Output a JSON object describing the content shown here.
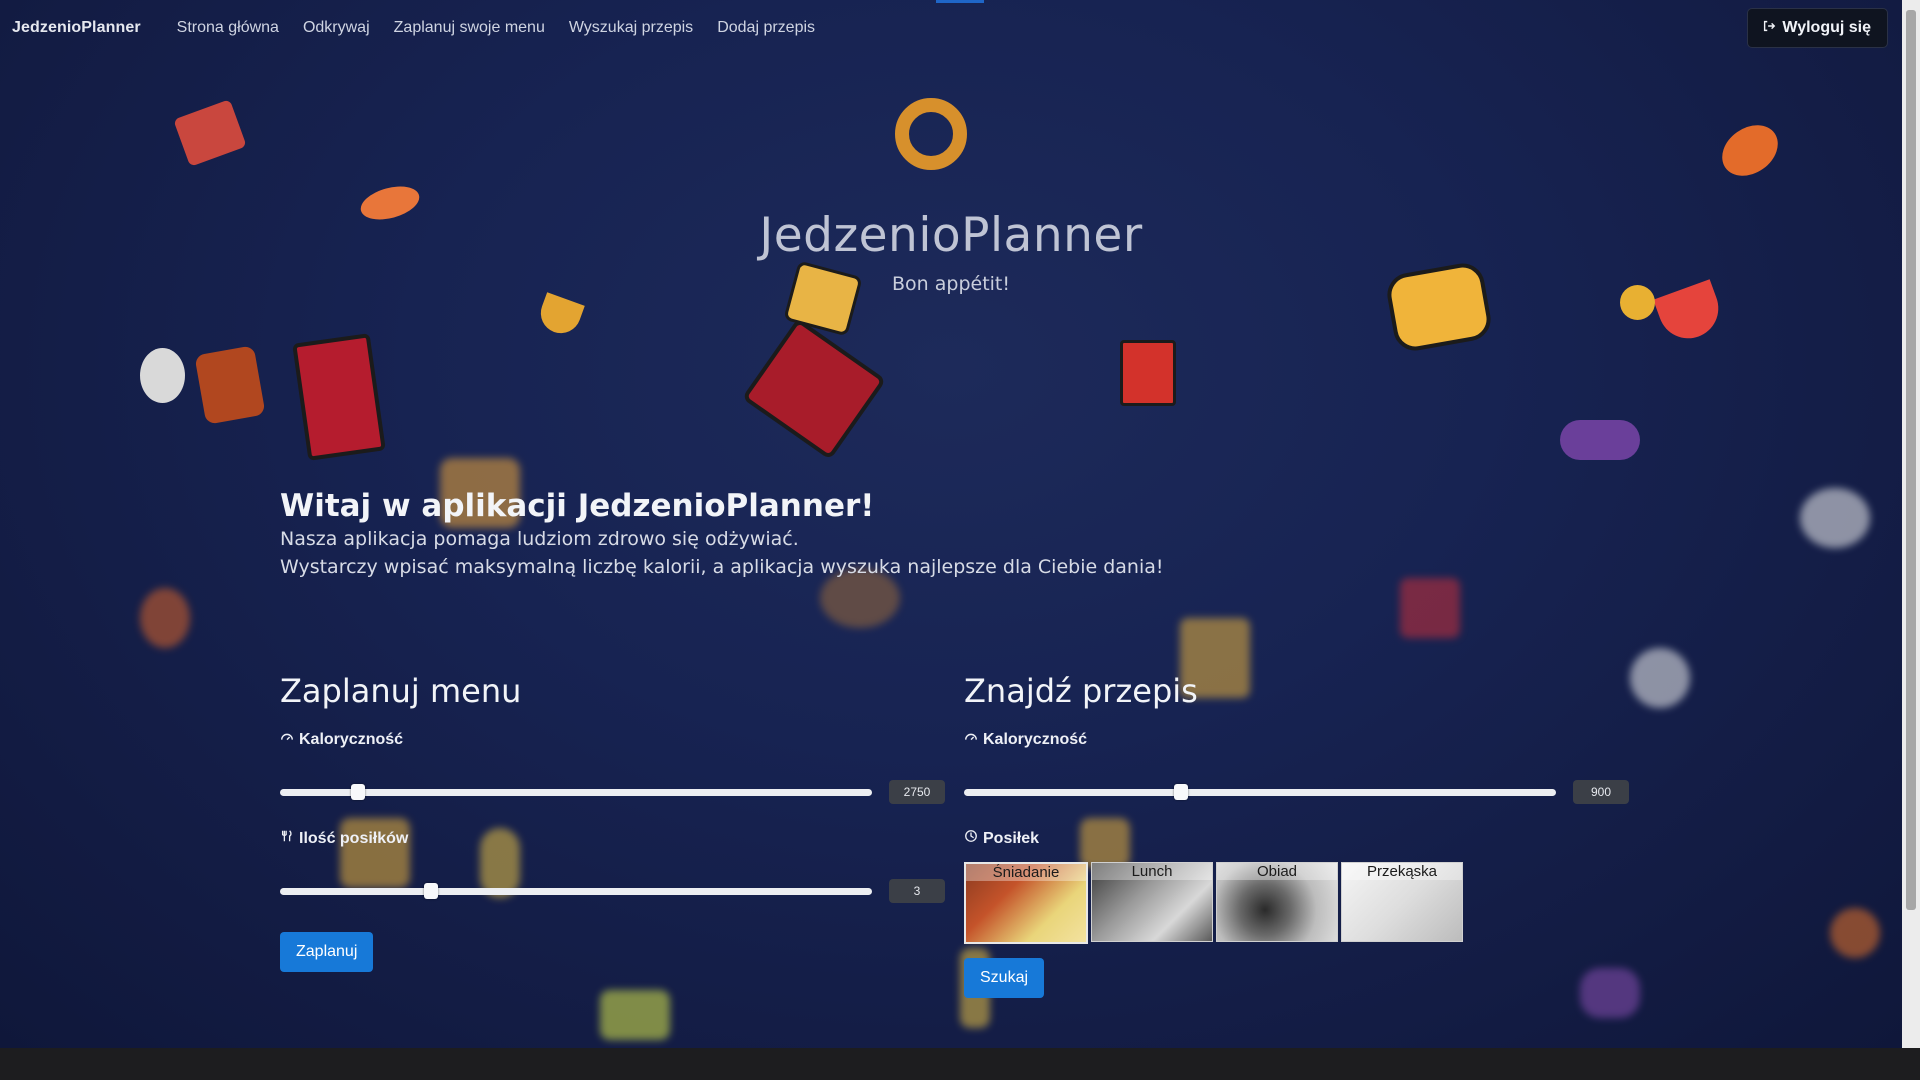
{
  "nav": {
    "brand": "JedzenioPlanner",
    "links": [
      "Strona główna",
      "Odkrywaj",
      "Zaplanuj swoje menu",
      "Wyszukaj przepis",
      "Dodaj przepis"
    ],
    "logout": "Wyloguj się"
  },
  "hero": {
    "title": "JedzenioPlanner",
    "subtitle": "Bon appétit!"
  },
  "intro": {
    "heading": "Witaj w aplikacji JedzenioPlanner!",
    "line1": "Nasza aplikacja pomaga ludziom zdrowo się odżywiać.",
    "line2": "Wystarczy wpisać maksymalną liczbę kalorii, a aplikacja wyszuka najlepsze dla Ciebie dania!"
  },
  "plan": {
    "title": "Zaplanuj menu",
    "calories_label": "Kaloryczność",
    "calories_value": "2750",
    "calories_fraction": 0.13,
    "meals_label": "Ilość posiłków",
    "meals_value": "3",
    "meals_fraction": 0.25,
    "button": "Zaplanuj"
  },
  "search": {
    "title": "Znajdź przepis",
    "calories_label": "Kaloryczność",
    "calories_value": "900",
    "calories_fraction": 0.36,
    "meal_label": "Posiłek",
    "meals": [
      "Śniadanie",
      "Lunch",
      "Obiad",
      "Przekąska"
    ],
    "selected_meal": "Śniadanie",
    "button": "Szukaj"
  },
  "colors": {
    "accent": "#1779d8",
    "background": "#17224a"
  }
}
